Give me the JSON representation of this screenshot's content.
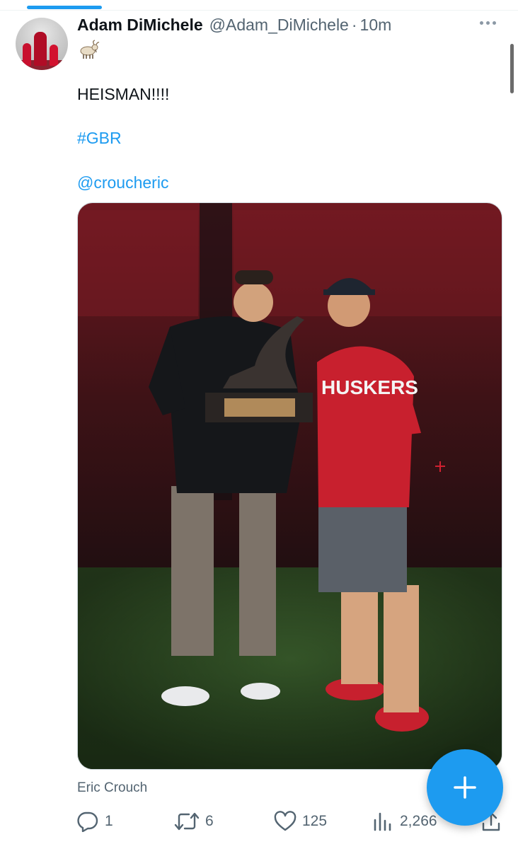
{
  "tweet": {
    "author": {
      "display_name": "Adam DiMichele",
      "handle": "@Adam_DiMichele",
      "separator": "·",
      "time": "10m",
      "bio_emoji": "goat-emoji"
    },
    "text_main": "HEISMAN!!!!",
    "hashtag": "#GBR",
    "mention": "@croucheric",
    "media": {
      "caption": "Eric Crouch",
      "shirt_text": "HUSKERS"
    },
    "stats": {
      "replies": "1",
      "retweets": "6",
      "likes": "125",
      "views": "2,266"
    }
  },
  "icons": {
    "more": "more-horizontal-icon",
    "reply": "reply-icon",
    "retweet": "retweet-icon",
    "like": "heart-icon",
    "views": "views-icon",
    "share": "share-icon",
    "compose": "plus-icon"
  },
  "colors": {
    "accent": "#1d9bf0",
    "muted": "#536471",
    "text": "#0f1419"
  }
}
